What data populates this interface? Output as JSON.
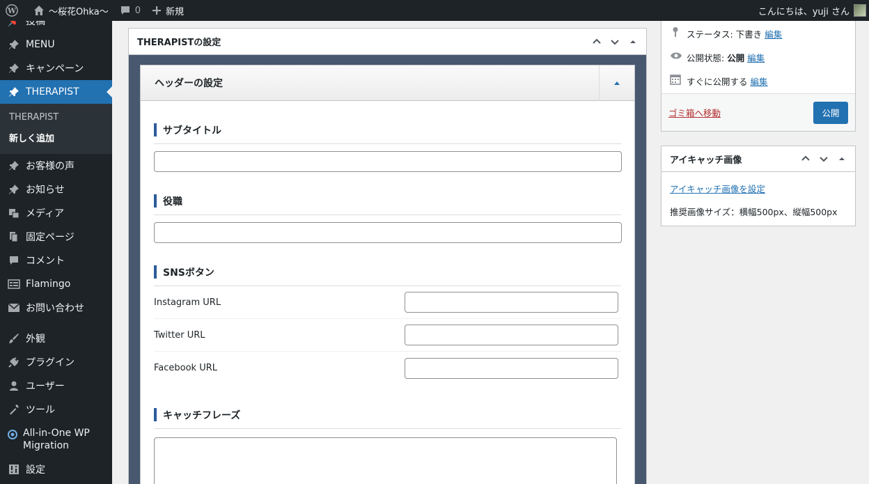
{
  "adminbar": {
    "site_name": "〜桜花Ohka〜",
    "comments_count": "0",
    "new_label": "新規",
    "greeting": "こんにちは、yuji さん"
  },
  "sidebar": {
    "items": [
      {
        "label": "投稿",
        "icon": "pin-icon"
      },
      {
        "label": "MENU",
        "icon": "pin-icon"
      },
      {
        "label": "キャンペーン",
        "icon": "pin-icon"
      },
      {
        "label": "THERAPIST",
        "icon": "pin-icon",
        "active": true
      }
    ],
    "submenu": {
      "all": "THERAPIST",
      "add_new": "新しく追加"
    },
    "items2": [
      {
        "label": "お客様の声"
      },
      {
        "label": "お知らせ"
      },
      {
        "label": "メディア"
      },
      {
        "label": "固定ページ"
      },
      {
        "label": "コメント"
      },
      {
        "label": "Flamingo"
      },
      {
        "label": "お問い合わせ"
      }
    ],
    "items3": [
      {
        "label": "外観"
      },
      {
        "label": "プラグイン"
      },
      {
        "label": "ユーザー"
      },
      {
        "label": "ツール"
      },
      {
        "label": "All-in-One WP Migration"
      },
      {
        "label": "設定"
      }
    ]
  },
  "metabox": {
    "title": "THERAPISTの設定",
    "inner_title": "ヘッダーの設定",
    "subtitle_label": "サブタイトル",
    "position_label": "役職",
    "sns_label": "SNSボタン",
    "sns_rows": [
      "Instagram URL",
      "Twitter URL",
      "Facebook URL"
    ],
    "catch_label": "キャッチフレーズ"
  },
  "publish": {
    "status_label": "ステータス: 下書き",
    "visibility_label": "公開状態:",
    "visibility_value": "公開",
    "schedule_label": "すぐに公開する",
    "edit": "編集",
    "trash": "ゴミ箱へ移動",
    "publish_button": "公開"
  },
  "eyecatch": {
    "title": "アイキャッチ画像",
    "set_link": "アイキャッチ画像を設定",
    "recommended": "推奨画像サイズ：横幅500px、縦幅500px"
  },
  "colors": {
    "accent": "#2271b1",
    "sidebar": "#1d2327",
    "inner_bg": "#47586f"
  }
}
